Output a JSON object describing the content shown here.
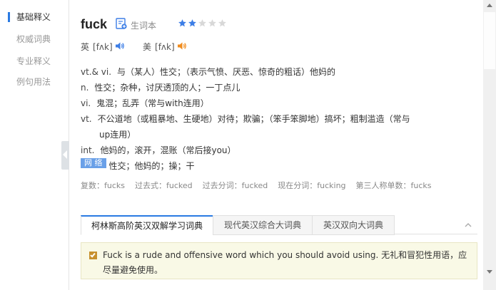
{
  "sidebar": {
    "items": [
      {
        "label": "基础释义",
        "active": true
      },
      {
        "label": "权威词典",
        "active": false
      },
      {
        "label": "专业释义",
        "active": false
      },
      {
        "label": "例句用法",
        "active": false
      }
    ]
  },
  "entry": {
    "word": "fuck",
    "wordbook_label": "生词本",
    "star_rating": 2,
    "star_max": 5,
    "phonetics": {
      "uk_label": "英",
      "uk_symbol": "[fʌk]",
      "us_label": "美",
      "us_symbol": "[fʌk]"
    },
    "definitions": [
      {
        "pos": "vt.& vi.",
        "text": "与（某人）性交；（表示气愤、厌恶、惊奇的粗话）他妈的"
      },
      {
        "pos": "n.",
        "text": "性交；杂种，讨厌透顶的人；一丁点儿"
      },
      {
        "pos": "vi.",
        "text": "鬼混；乱弄（常与with连用）"
      },
      {
        "pos": "vt.",
        "text": "不公道地（或粗暴地、生硬地）对待；欺骗；（笨手笨脚地）搞坏；粗制滥造（常与",
        "cont": "up连用）"
      },
      {
        "pos": "int.",
        "text": "他妈的，滚开，混账（常后接you）"
      }
    ],
    "web": {
      "badge": "网 络",
      "text": "性交；他妈的；操；干"
    },
    "forms": [
      "复数：fucks",
      "过去式：fucked",
      "过去分词：fucked",
      "现在分词：fucking",
      "第三人称单数：fucks"
    ]
  },
  "dict_tabs": [
    {
      "label": "柯林斯高阶英汉双解学习词典",
      "active": true
    },
    {
      "label": "现代英汉综合大词典",
      "active": false
    },
    {
      "label": "英汉双向大词典",
      "active": false
    }
  ],
  "collins": {
    "text": "Fuck is a rude and offensive word which you should avoid using. 无礼和冒犯性用语，应尽量避免使用。"
  },
  "colors": {
    "accent": "#2a7ae2",
    "star_on": "#3d7ee6",
    "star_off": "#d8d8d8",
    "speaker_blue": "#3d7ee6",
    "speaker_orange": "#f08c1e",
    "badge": "#6aa0e8",
    "collins_bg": "#f9f9e6"
  },
  "icons": {
    "wordbook": "add-to-wordbook-icon",
    "speaker": "speaker-icon",
    "collapse": "chevron-left-icon",
    "tabs_toggle": "chevron-up-icon"
  }
}
